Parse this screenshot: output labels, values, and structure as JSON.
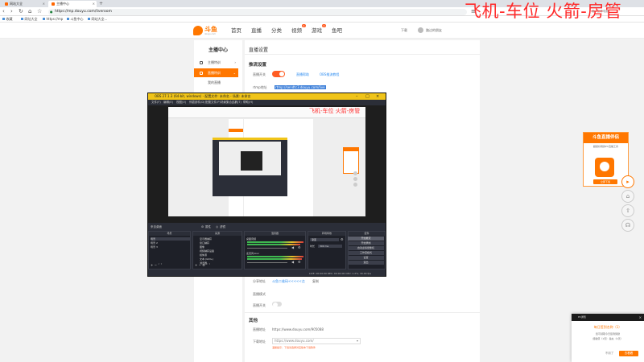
{
  "browser": {
    "tabs": [
      {
        "label": "网站大全"
      },
      {
        "label": "主播中心"
      }
    ],
    "url": "https://mp.douyu.com/liveroom",
    "bookmarks": [
      "收藏",
      "网址大全",
      "https://mp",
      "斗鱼中心",
      "网站大全..."
    ]
  },
  "overlay": {
    "text": "飞机-车位  火箭-房管",
    "small": "高 · 工作电脑"
  },
  "site": {
    "logo": "斗鱼",
    "logo_sub": "douyu.com",
    "nav": [
      "首页",
      "直播",
      "分类",
      "视频",
      "游戏",
      "鱼吧"
    ],
    "badges": {
      "video": "1",
      "game": "1"
    },
    "header_right": [
      "下载",
      "路过的朋友"
    ]
  },
  "sidebar": {
    "title": "主播中心",
    "items": [
      {
        "label": "主播特训"
      },
      {
        "label": "直播特训"
      },
      {
        "label": "我的直播"
      }
    ]
  },
  "main": {
    "title": "直播设置",
    "sections": {
      "push": "推流设置",
      "other": "其他"
    },
    "rows": {
      "live_switch": "直播开关",
      "rtmp_label": "rtmp地址",
      "play_link": "播放地址",
      "live_title_toggle": "直播开关",
      "link_a": "直播帮助",
      "link_b": "OBS推流教程",
      "rtmp_value": "rtmp://sendtc3.douyu.com/live",
      "share_label": "分享地址",
      "share_link": "斗鱼二维码<<<<<点",
      "share_extra": "复制",
      "mute_label": "直播模式",
      "auto_label": "直播开关",
      "room_label": "直播地址",
      "room_url": "https://www.douyu.com/905088",
      "download_label": "下载地址",
      "download_value": "https://www.douyu.com/",
      "warn": "温馨提示：下载请选择对应版本下载软件"
    }
  },
  "obs": {
    "title": "OBS 27.1.3 (64-bit, windows) - 配置文件: 未命名 - 场景: 未命名",
    "menu": [
      "文件(F)",
      "编辑(E)",
      "视图(V)",
      "停靠部件(D)",
      "配置文件(P)",
      "场景集合(S)",
      "工具(T)",
      "帮助(H)"
    ],
    "toolbar": [
      "来自桌面",
      "属性",
      "滤镜"
    ],
    "docks": {
      "scenes": {
        "title": "场景",
        "items": [
          "场景",
          "场景 2",
          "场景 3"
        ]
      },
      "sources": {
        "title": "来源",
        "items": [
          "显示器捕获",
          "窗口捕获",
          "图像",
          "视频捕获设备",
          "媒体源",
          "文本 (GDI+)",
          "浏览器"
        ]
      },
      "mixer": {
        "title": "混音器",
        "items": [
          "桌面音频",
          "麦克风/Aux"
        ]
      },
      "transitions": {
        "title": "转场特效",
        "fade": "渐变",
        "duration_label": "时长",
        "duration": "300 ms"
      },
      "controls": {
        "title": "控件",
        "buttons": [
          "开始推流",
          "开始录制",
          "启动虚拟摄像机",
          "工作室模式",
          "设置",
          "退出"
        ]
      }
    },
    "status": "LIVE: 00:00:00  REC: 00:00:00  CPU: 1.2%, 30.00 fps",
    "preview_overlay": "飞机-车位  火箭-房管"
  },
  "ad": {
    "title": "斗鱼直播伴侣",
    "desc": "超级好用的PC直播工具",
    "button": "立即下载"
  },
  "popup": {
    "header": "PC通知",
    "title": "每日签到名称（1）",
    "desc1": "您可领取今日签到奖励",
    "desc2": "经验值（1天）· 鱼丸（1天）",
    "secondary": "不用了",
    "primary": "去看看"
  }
}
